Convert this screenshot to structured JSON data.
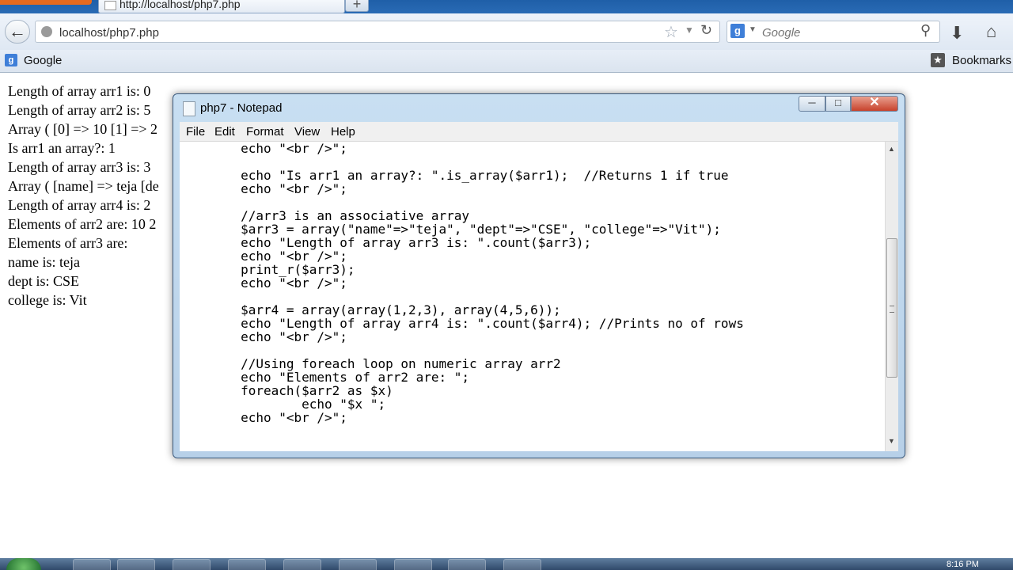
{
  "browser": {
    "tab_title": "http://localhost/php7.php",
    "url": "localhost/php7.php",
    "search_placeholder": "Google",
    "bookmarks_bar": {
      "items": [
        "Google"
      ],
      "bookmarks_label": "Bookmarks"
    }
  },
  "page_output": {
    "lines": [
      "Length of array arr1 is: 0",
      "Length of array arr2 is: 5",
      "Array ( [0] => 10 [1] => 2",
      "Is arr1 an array?: 1",
      "Length of array arr3 is: 3",
      "Array ( [name] => teja [de",
      "Length of array arr4 is: 2",
      "Elements of arr2 are: 10 2",
      "Elements of arr3 are:",
      "name is: teja",
      "dept is: CSE",
      "college is: Vit"
    ]
  },
  "notepad": {
    "title": "php7 - Notepad",
    "menu": [
      "File",
      "Edit",
      "Format",
      "View",
      "Help"
    ],
    "code_lines": [
      "        echo \"<br />\";",
      "",
      "        echo \"Is arr1 an array?: \".is_array($arr1);  //Returns 1 if true",
      "        echo \"<br />\";",
      "",
      "        //arr3 is an associative array",
      "        $arr3 = array(\"name\"=>\"teja\", \"dept\"=>\"CSE\", \"college\"=>\"Vit\");",
      "        echo \"Length of array arr3 is: \".count($arr3);",
      "        echo \"<br />\";",
      "        print_r($arr3);",
      "        echo \"<br />\";",
      "",
      "        $arr4 = array(array(1,2,3), array(4,5,6));",
      "        echo \"Length of array arr4 is: \".count($arr4); //Prints no of rows",
      "        echo \"<br />\";",
      "",
      "        //Using foreach loop on numeric array arr2",
      "        echo \"Elements of arr2 are: \";",
      "        foreach($arr2 as $x)",
      "                echo \"$x \";",
      "        echo \"<br />\";"
    ]
  },
  "taskbar": {
    "clock": "8:16 PM"
  },
  "colors": {
    "browser_toolbar": "#dfe8f3",
    "notepad_frame": "#b7d0e8",
    "close_button": "#c7422c",
    "taskbar": "#30496a"
  }
}
